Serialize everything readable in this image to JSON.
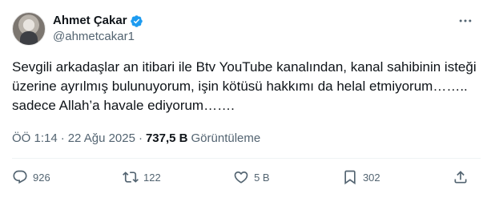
{
  "author": {
    "display_name": "Ahmet Çakar",
    "handle": "@ahmetcakar1",
    "verified_color": "#1d9bf0"
  },
  "tweet": {
    "text": "Sevgili arkadaşlar an itibari ile Btv YouTube kanalından, kanal sahibinin isteği üzerine ayrılmış bulunuyorum, işin kötüsü hakkımı da helal etmiyorum…….. sadece Allah’a havale ediyorum……."
  },
  "meta": {
    "time": "ÖÖ 1:14",
    "separator": "·",
    "date": "22 Ağu 2025",
    "views_count": "737,5 B",
    "views_label": "Görüntüleme"
  },
  "actions": {
    "replies": "926",
    "retweets": "122",
    "likes": "5 B",
    "bookmarks": "302"
  },
  "icons": {
    "more": "more-icon",
    "reply": "reply-icon",
    "retweet": "retweet-icon",
    "like": "heart-icon",
    "bookmark": "bookmark-icon",
    "share": "share-icon"
  },
  "colors": {
    "text": "#0f1419",
    "secondary": "#536471",
    "accent": "#1d9bf0",
    "divider": "#eff3f4"
  }
}
